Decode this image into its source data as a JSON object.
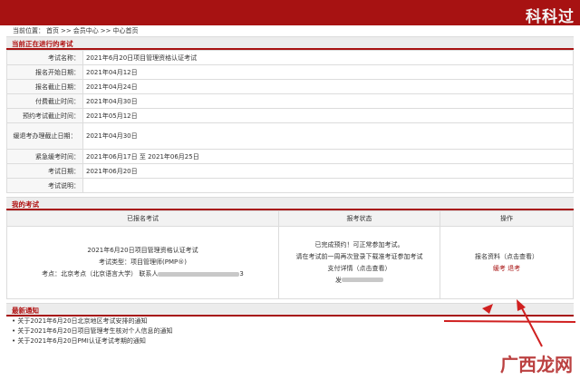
{
  "brand": "科科过",
  "breadcrumb": {
    "prefix": "当前位置：",
    "items": [
      "首页",
      ">>",
      "会员中心",
      ">>",
      "中心首页"
    ]
  },
  "current_exam": {
    "title": "当前正在进行的考试",
    "rows": [
      {
        "label": "考试名称：",
        "value": "2021年6月20日项目管理资格认证考试"
      },
      {
        "label": "报名开始日期：",
        "value": "2021年04月12日"
      },
      {
        "label": "报名截止日期：",
        "value": "2021年04月24日"
      },
      {
        "label": "付费截止时间：",
        "value": "2021年04月30日"
      },
      {
        "label": "预约考试截止时间：",
        "value": "2021年05月12日"
      },
      {
        "label": "缓退考办理截止日期：",
        "value": "2021年04月30日"
      },
      {
        "label": "紧急缓考时间：",
        "value": "2021年06月17日 至 2021年06月25日"
      },
      {
        "label": "考试日期：",
        "value": "2021年06月20日"
      },
      {
        "label": "考试说明：",
        "value": ""
      }
    ]
  },
  "my_exams": {
    "title": "我的考试",
    "headers": [
      "已报名考试",
      "报考状态",
      "操作"
    ],
    "exam_name": "2021年6月20日项目管理资格认证考试",
    "exam_type": "考试类型：项目管理师(PMP®)",
    "exam_site": "考点：北京考点（北京语言大学）  联系人",
    "exam_site_tail": "3",
    "status_line1": "已完成预约！可正常参加考试。",
    "status_line2": "请在考试前一周再次登录下载准考证参加考试",
    "status_line3": "支付详情（点击查看）",
    "status_line4": "发",
    "ops_label": "报名资料（点击查看）",
    "ops_postpone": "缓考",
    "ops_withdraw": "退考"
  },
  "news": {
    "title": "最新通知",
    "items": [
      "关于2021年6月20日北京地区考试安排的通知",
      "关于2021年6月20日项目管理考生核对个人信息的通知",
      "关于2021年6月20日PMI认证考试考期的通知"
    ]
  },
  "watermark": "广西龙网",
  "colors": {
    "brand_red": "#a71212",
    "arrow_red": "#d02020"
  }
}
